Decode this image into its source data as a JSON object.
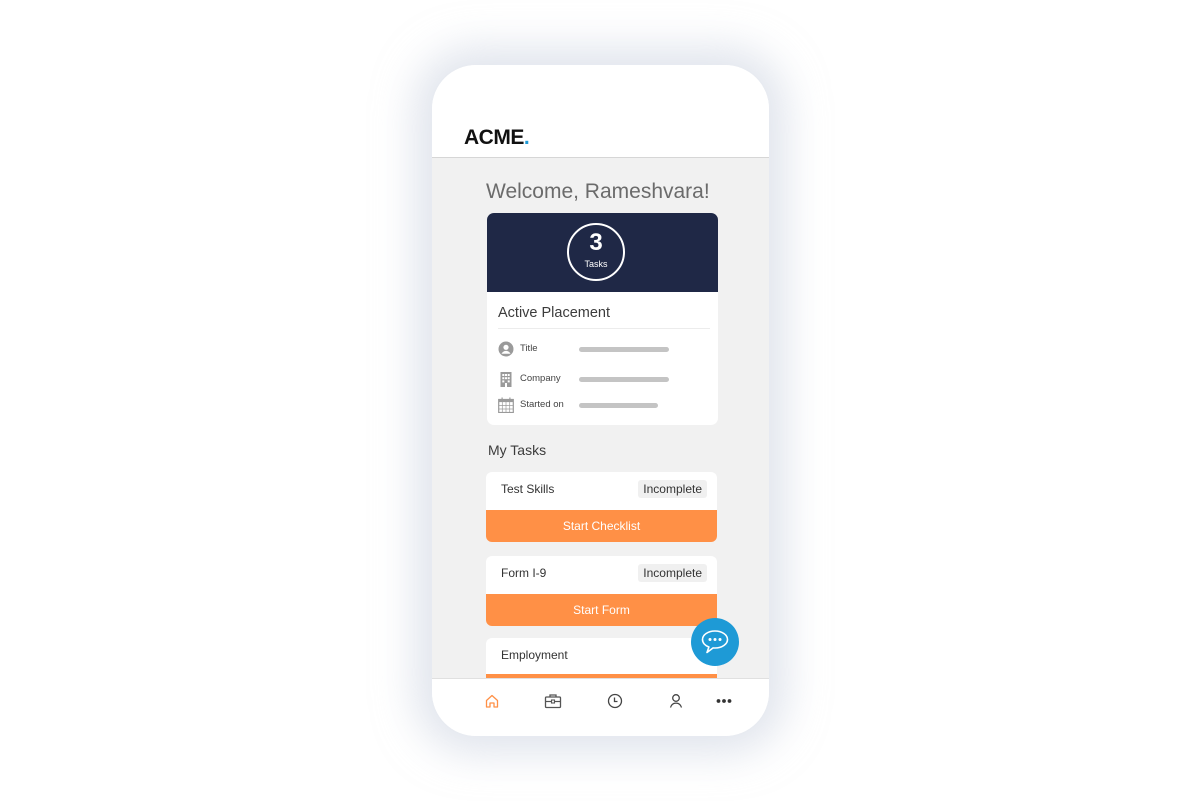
{
  "app": {
    "logo_text": "ACME",
    "logo_dot": ".",
    "brand_colors": {
      "navy": "#1f2846",
      "orange": "#ff9046",
      "blue": "#1e9ad6"
    }
  },
  "main": {
    "welcome": "Welcome, Rameshvara!",
    "summary": {
      "task_count": "3",
      "task_label": "Tasks",
      "active_placement_title": "Active Placement",
      "rows": [
        {
          "icon": "user-icon",
          "label": "Title"
        },
        {
          "icon": "building-icon",
          "label": "Company"
        },
        {
          "icon": "calendar-icon",
          "label": "Started on"
        }
      ]
    },
    "my_tasks_title": "My Tasks",
    "tasks": [
      {
        "name": "Test Skills",
        "status": "Incomplete",
        "action": "Start Checklist"
      },
      {
        "name": "Form I-9",
        "status": "Incomplete",
        "action": "Start Form"
      },
      {
        "name": "Employment",
        "status": "",
        "action": ""
      }
    ]
  },
  "chat": {
    "icon": "chat-bubble-icon"
  },
  "bottom_nav": {
    "items": [
      {
        "icon": "home-icon",
        "active": true
      },
      {
        "icon": "briefcase-icon",
        "active": false
      },
      {
        "icon": "clock-icon",
        "active": false
      },
      {
        "icon": "profile-icon",
        "active": false
      },
      {
        "icon": "more-icon",
        "active": false
      }
    ]
  }
}
